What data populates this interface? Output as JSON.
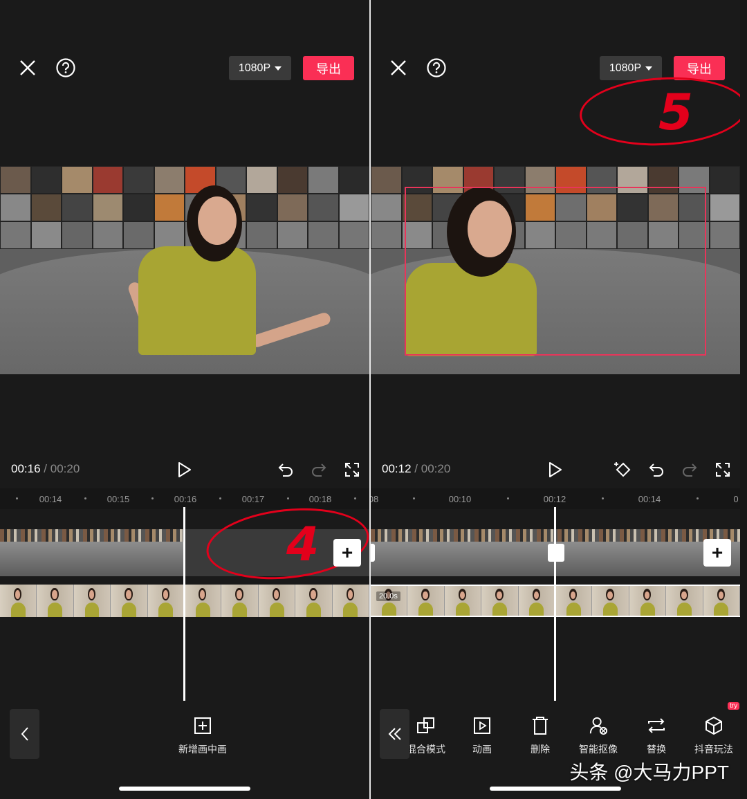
{
  "left": {
    "resolution": "1080P",
    "export": "导出",
    "time_current": "00:16",
    "time_sep": "/",
    "time_total": "00:20",
    "ruler": [
      "00:14",
      "00:15",
      "00:16",
      "00:17",
      "00:18"
    ],
    "tool_add_pip": "新增画中画",
    "annotation_number": "4"
  },
  "right": {
    "resolution": "1080P",
    "export": "导出",
    "time_current": "00:12",
    "time_sep": "/",
    "time_total": "00:20",
    "ruler_partial_left": "08",
    "ruler": [
      "00:10",
      "00:12",
      "00:14"
    ],
    "ruler_partial_right": "0",
    "clip_duration": "20.0s",
    "tools": [
      "混合模式",
      "动画",
      "删除",
      "智能抠像",
      "替换",
      "抖音玩法"
    ],
    "badge": "try",
    "annotation_number": "5"
  },
  "watermark": "头条 @大马力PPT",
  "icons": [
    "close-icon",
    "help-icon",
    "dropdown-arrow-icon",
    "play-icon",
    "undo-icon",
    "redo-icon",
    "fullscreen-icon",
    "keyframe-icon",
    "back-chevron-icon",
    "collapse-double-chevron-icon",
    "add-icon",
    "blend-mode-icon",
    "animation-icon",
    "delete-icon",
    "smart-cutout-icon",
    "replace-icon",
    "effects-icon"
  ],
  "colors": {
    "accent": "#fa2f55",
    "annotation": "#e3001b",
    "background": "#1a1a1a"
  }
}
